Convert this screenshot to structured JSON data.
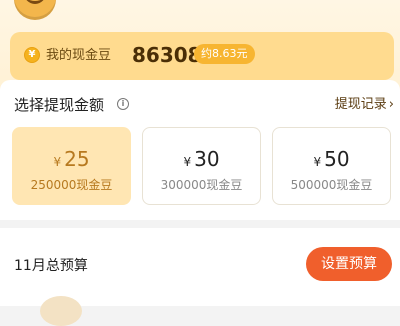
{
  "balance": {
    "label": "我的现金豆",
    "value": "86308",
    "approx": "约8.63元"
  },
  "withdraw": {
    "title": "选择提现金额",
    "record_link": "提现记录",
    "options": [
      {
        "symbol": "¥",
        "amount": "25",
        "beans": "250000现金豆",
        "selected": true
      },
      {
        "symbol": "¥",
        "amount": "30",
        "beans": "300000现金豆",
        "selected": false
      },
      {
        "symbol": "¥",
        "amount": "50",
        "beans": "500000现金豆",
        "selected": false
      }
    ]
  },
  "budget": {
    "title": "11月总预算",
    "set_button": "设置预算"
  },
  "colors": {
    "accent": "#f05f2c",
    "selected_bg": "#ffe6b3",
    "card_bg": "#ffdb8f"
  }
}
